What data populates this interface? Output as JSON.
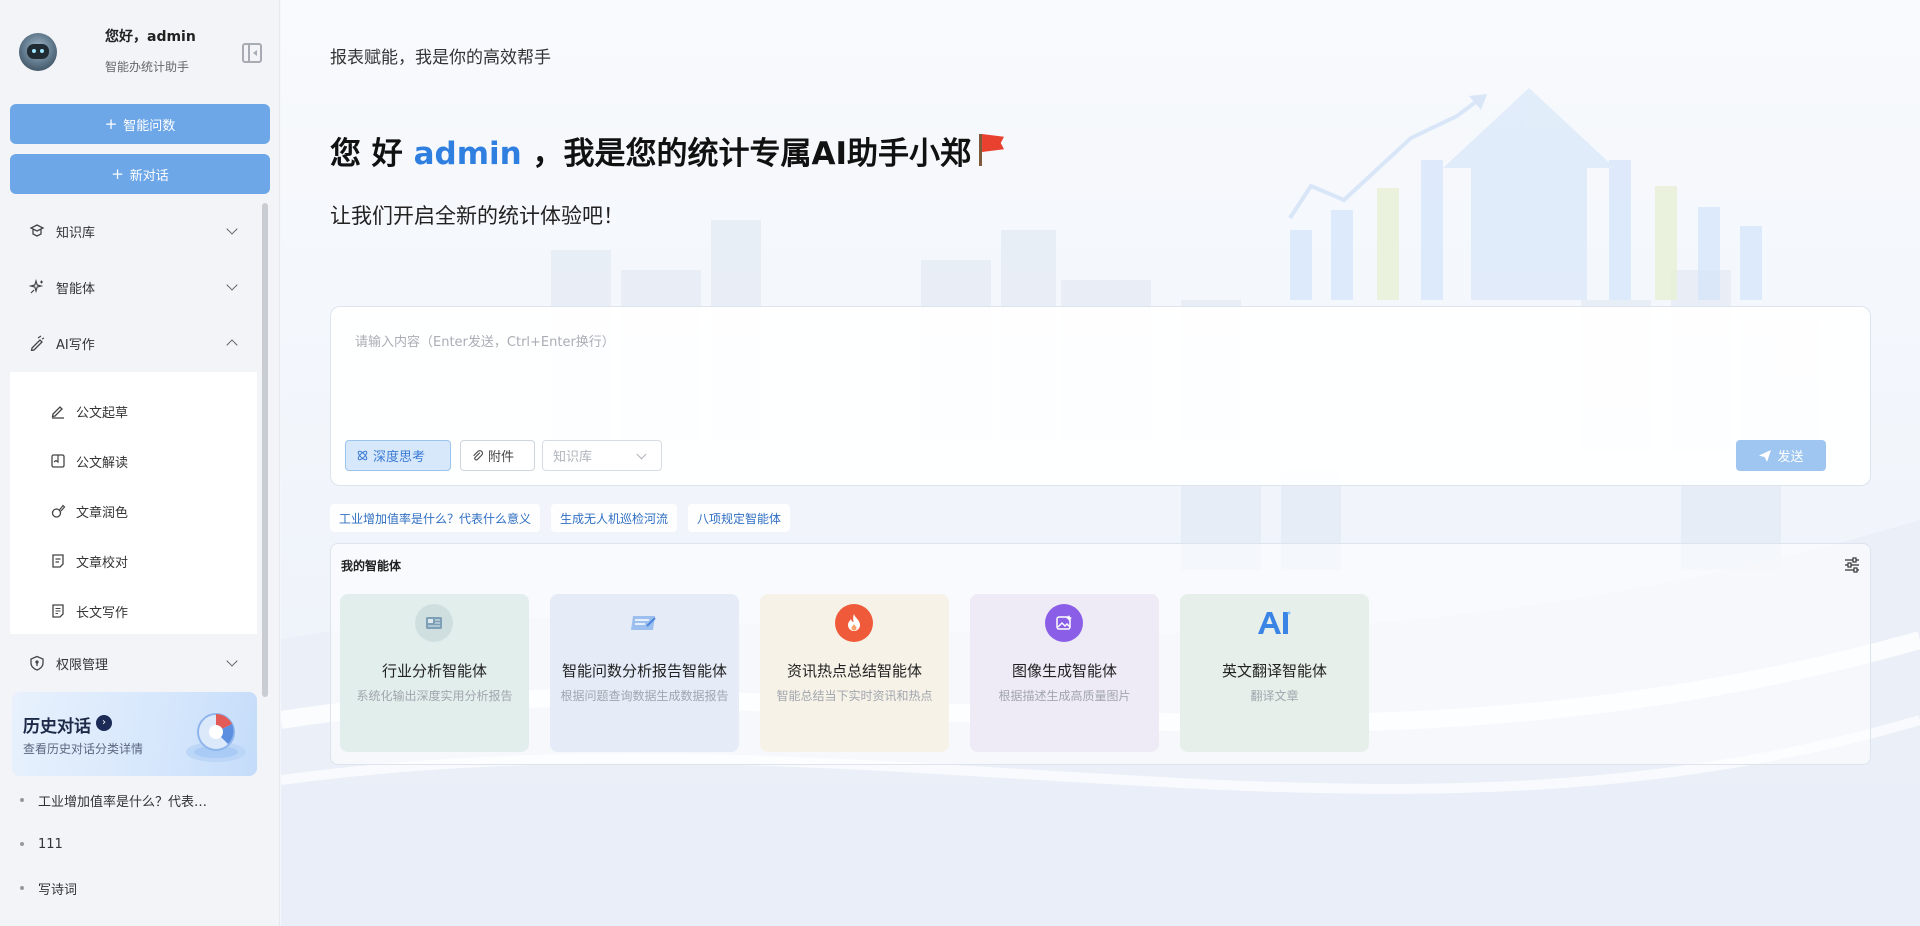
{
  "user": {
    "greeting": "您好，admin",
    "subtitle": "智能办统计助手"
  },
  "sidebar": {
    "new_qa_label": "智能问数",
    "new_chat_label": "新对话",
    "menu": [
      {
        "label": "知识库",
        "icon": "knowledge-icon",
        "expanded": false
      },
      {
        "label": "智能体",
        "icon": "agent-sparkle-icon",
        "expanded": false
      },
      {
        "label": "AI写作",
        "icon": "ai-pen-icon",
        "expanded": true
      },
      {
        "label": "权限管理",
        "icon": "shield-icon",
        "expanded": false
      }
    ],
    "writing_items": [
      {
        "label": "公文起草",
        "icon": "pen-icon"
      },
      {
        "label": "公文解读",
        "icon": "book-icon"
      },
      {
        "label": "文章润色",
        "icon": "polish-icon"
      },
      {
        "label": "文章校对",
        "icon": "proofread-icon"
      },
      {
        "label": "长文写作",
        "icon": "longform-icon"
      }
    ],
    "history": {
      "title": "历史对话",
      "subtitle": "查看历史对话分类详情",
      "items": [
        {
          "label": "工业增加值率是什么？代表什么意义"
        },
        {
          "label": "111"
        },
        {
          "label": "写诗词"
        }
      ]
    }
  },
  "main": {
    "topline": "报表赋能，我是你的高效帮手",
    "hero": {
      "prefix": "您 好",
      "name": "admin",
      "suffix": "，我是您的统计专属AI助手小郑"
    },
    "subhero": "让我们开启全新的统计体验吧！",
    "composer": {
      "placeholder": "请输入内容（Enter发送，Ctrl+Enter换行）",
      "value": "",
      "deep_think_label": "深度思考",
      "attach_label": "附件",
      "kb_placeholder": "知识库",
      "send_label": "发送"
    },
    "suggestions": [
      {
        "label": "工业增加值率是什么？代表什么意义"
      },
      {
        "label": "生成无人机巡检河流"
      },
      {
        "label": "八项规定智能体"
      }
    ],
    "agents": {
      "title": "我的智能体",
      "items": [
        {
          "name": "行业分析智能体",
          "desc": "系统化输出深度实用分析报告",
          "bg": "#e2eeec",
          "icon_bg": "#cfdfe0",
          "icon": "industry-analysis-icon"
        },
        {
          "name": "智能问数分析报告智能体",
          "desc": "根据问题查询数据生成数据报告",
          "bg": "#e5ecf8",
          "icon_bg": "transparent",
          "icon": "report-icon"
        },
        {
          "name": "资讯热点总结智能体",
          "desc": "智能总结当下实时资讯和热点",
          "bg": "#f6f2e7",
          "icon_bg": "#ef5b3a",
          "icon": "fire-icon"
        },
        {
          "name": "图像生成智能体",
          "desc": "根据描述生成高质量图片",
          "bg": "#eeeaf6",
          "icon_bg": "#8a5ee6",
          "icon": "image-gen-icon"
        },
        {
          "name": "英文翻译智能体",
          "desc": "翻译文章",
          "bg": "#e6efe9",
          "icon_bg": "transparent",
          "icon": "ai-translate-icon"
        }
      ]
    }
  },
  "colors": {
    "accent": "#2f7fe0",
    "primary_button": "#6ea7e8",
    "send_button": "#9ec6f0"
  }
}
